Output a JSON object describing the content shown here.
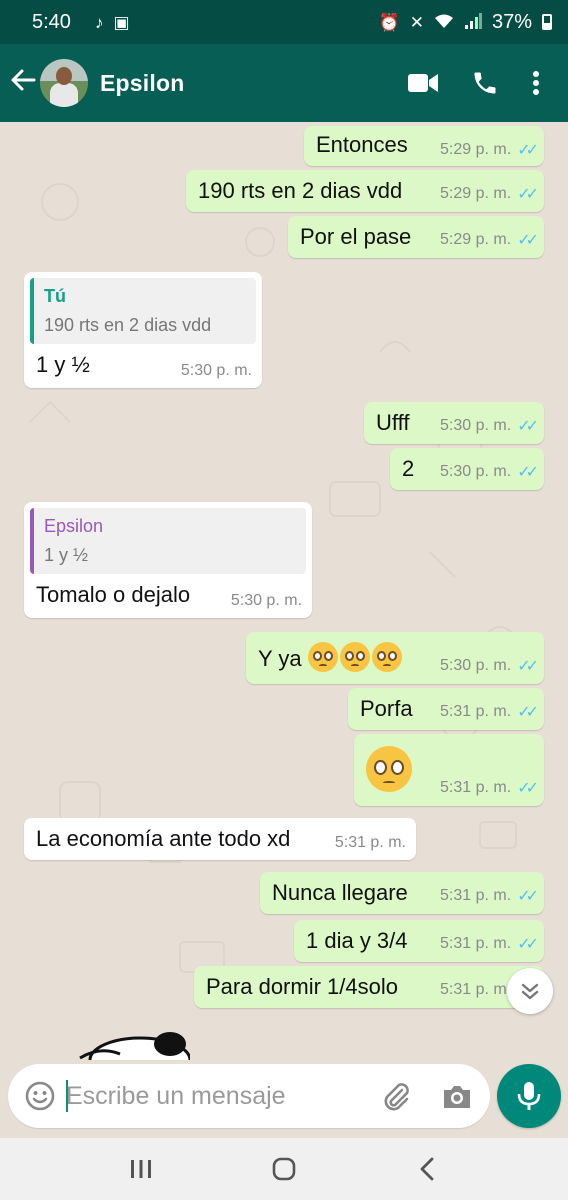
{
  "status_bar": {
    "time": "5:40",
    "battery": "37%",
    "icons": [
      "tiktok-icon",
      "gallery-icon",
      "alarm-icon",
      "mute-icon",
      "wifi-icon",
      "signal-icon",
      "battery-icon"
    ]
  },
  "header": {
    "contact_name": "Epsilon",
    "actions": [
      "video-call-icon",
      "voice-call-icon",
      "more-options-icon"
    ]
  },
  "messages": [
    {
      "dir": "out",
      "text": "Entonces",
      "time": "5:29 p. m.",
      "read": true
    },
    {
      "dir": "out",
      "text": "190 rts en 2 dias vdd",
      "time": "5:29 p. m.",
      "read": true
    },
    {
      "dir": "out",
      "text": "Por el pase",
      "time": "5:29 p. m.",
      "read": true
    },
    {
      "dir": "in",
      "quote_name": "Tú",
      "quote_text": "190 rts en 2 dias vdd",
      "text": "1 y ½",
      "time": "5:30 p. m."
    },
    {
      "dir": "out",
      "text": "Ufff",
      "time": "5:30 p. m.",
      "read": true
    },
    {
      "dir": "out",
      "text": "2",
      "time": "5:30 p. m.",
      "read": true
    },
    {
      "dir": "in",
      "quote_name": "Epsilon",
      "quote_text": "1 y ½",
      "text": "Tomalo o dejalo",
      "time": "5:30 p. m."
    },
    {
      "dir": "out",
      "text": "Y ya",
      "emoji_count": 3,
      "emoji": "pleading-face",
      "time": "5:30 p. m.",
      "read": true
    },
    {
      "dir": "out",
      "text": "Porfa",
      "time": "5:31 p. m.",
      "read": true
    },
    {
      "dir": "out",
      "text": "",
      "emoji_count": 1,
      "emoji": "pleading-face",
      "time": "5:31 p. m.",
      "read": true
    },
    {
      "dir": "in",
      "text": "La economía ante todo xd",
      "time": "5:31 p. m."
    },
    {
      "dir": "out",
      "text": "Nunca llegare",
      "time": "5:31 p. m.",
      "read": true
    },
    {
      "dir": "out",
      "text": "1 dia y 3/4",
      "time": "5:31 p. m.",
      "read": true
    },
    {
      "dir": "out",
      "text": "Para dormir 1/4solo",
      "time": "5:31 p. m.",
      "read": true
    }
  ],
  "composer": {
    "placeholder": "Escribe un mensaje"
  },
  "colors": {
    "header": "#075e54",
    "statusbar": "#054d44",
    "outgoing_bubble": "#dcf8c6",
    "incoming_bubble": "#ffffff",
    "read_ticks": "#4fc3f7",
    "mic_button": "#00897b"
  }
}
